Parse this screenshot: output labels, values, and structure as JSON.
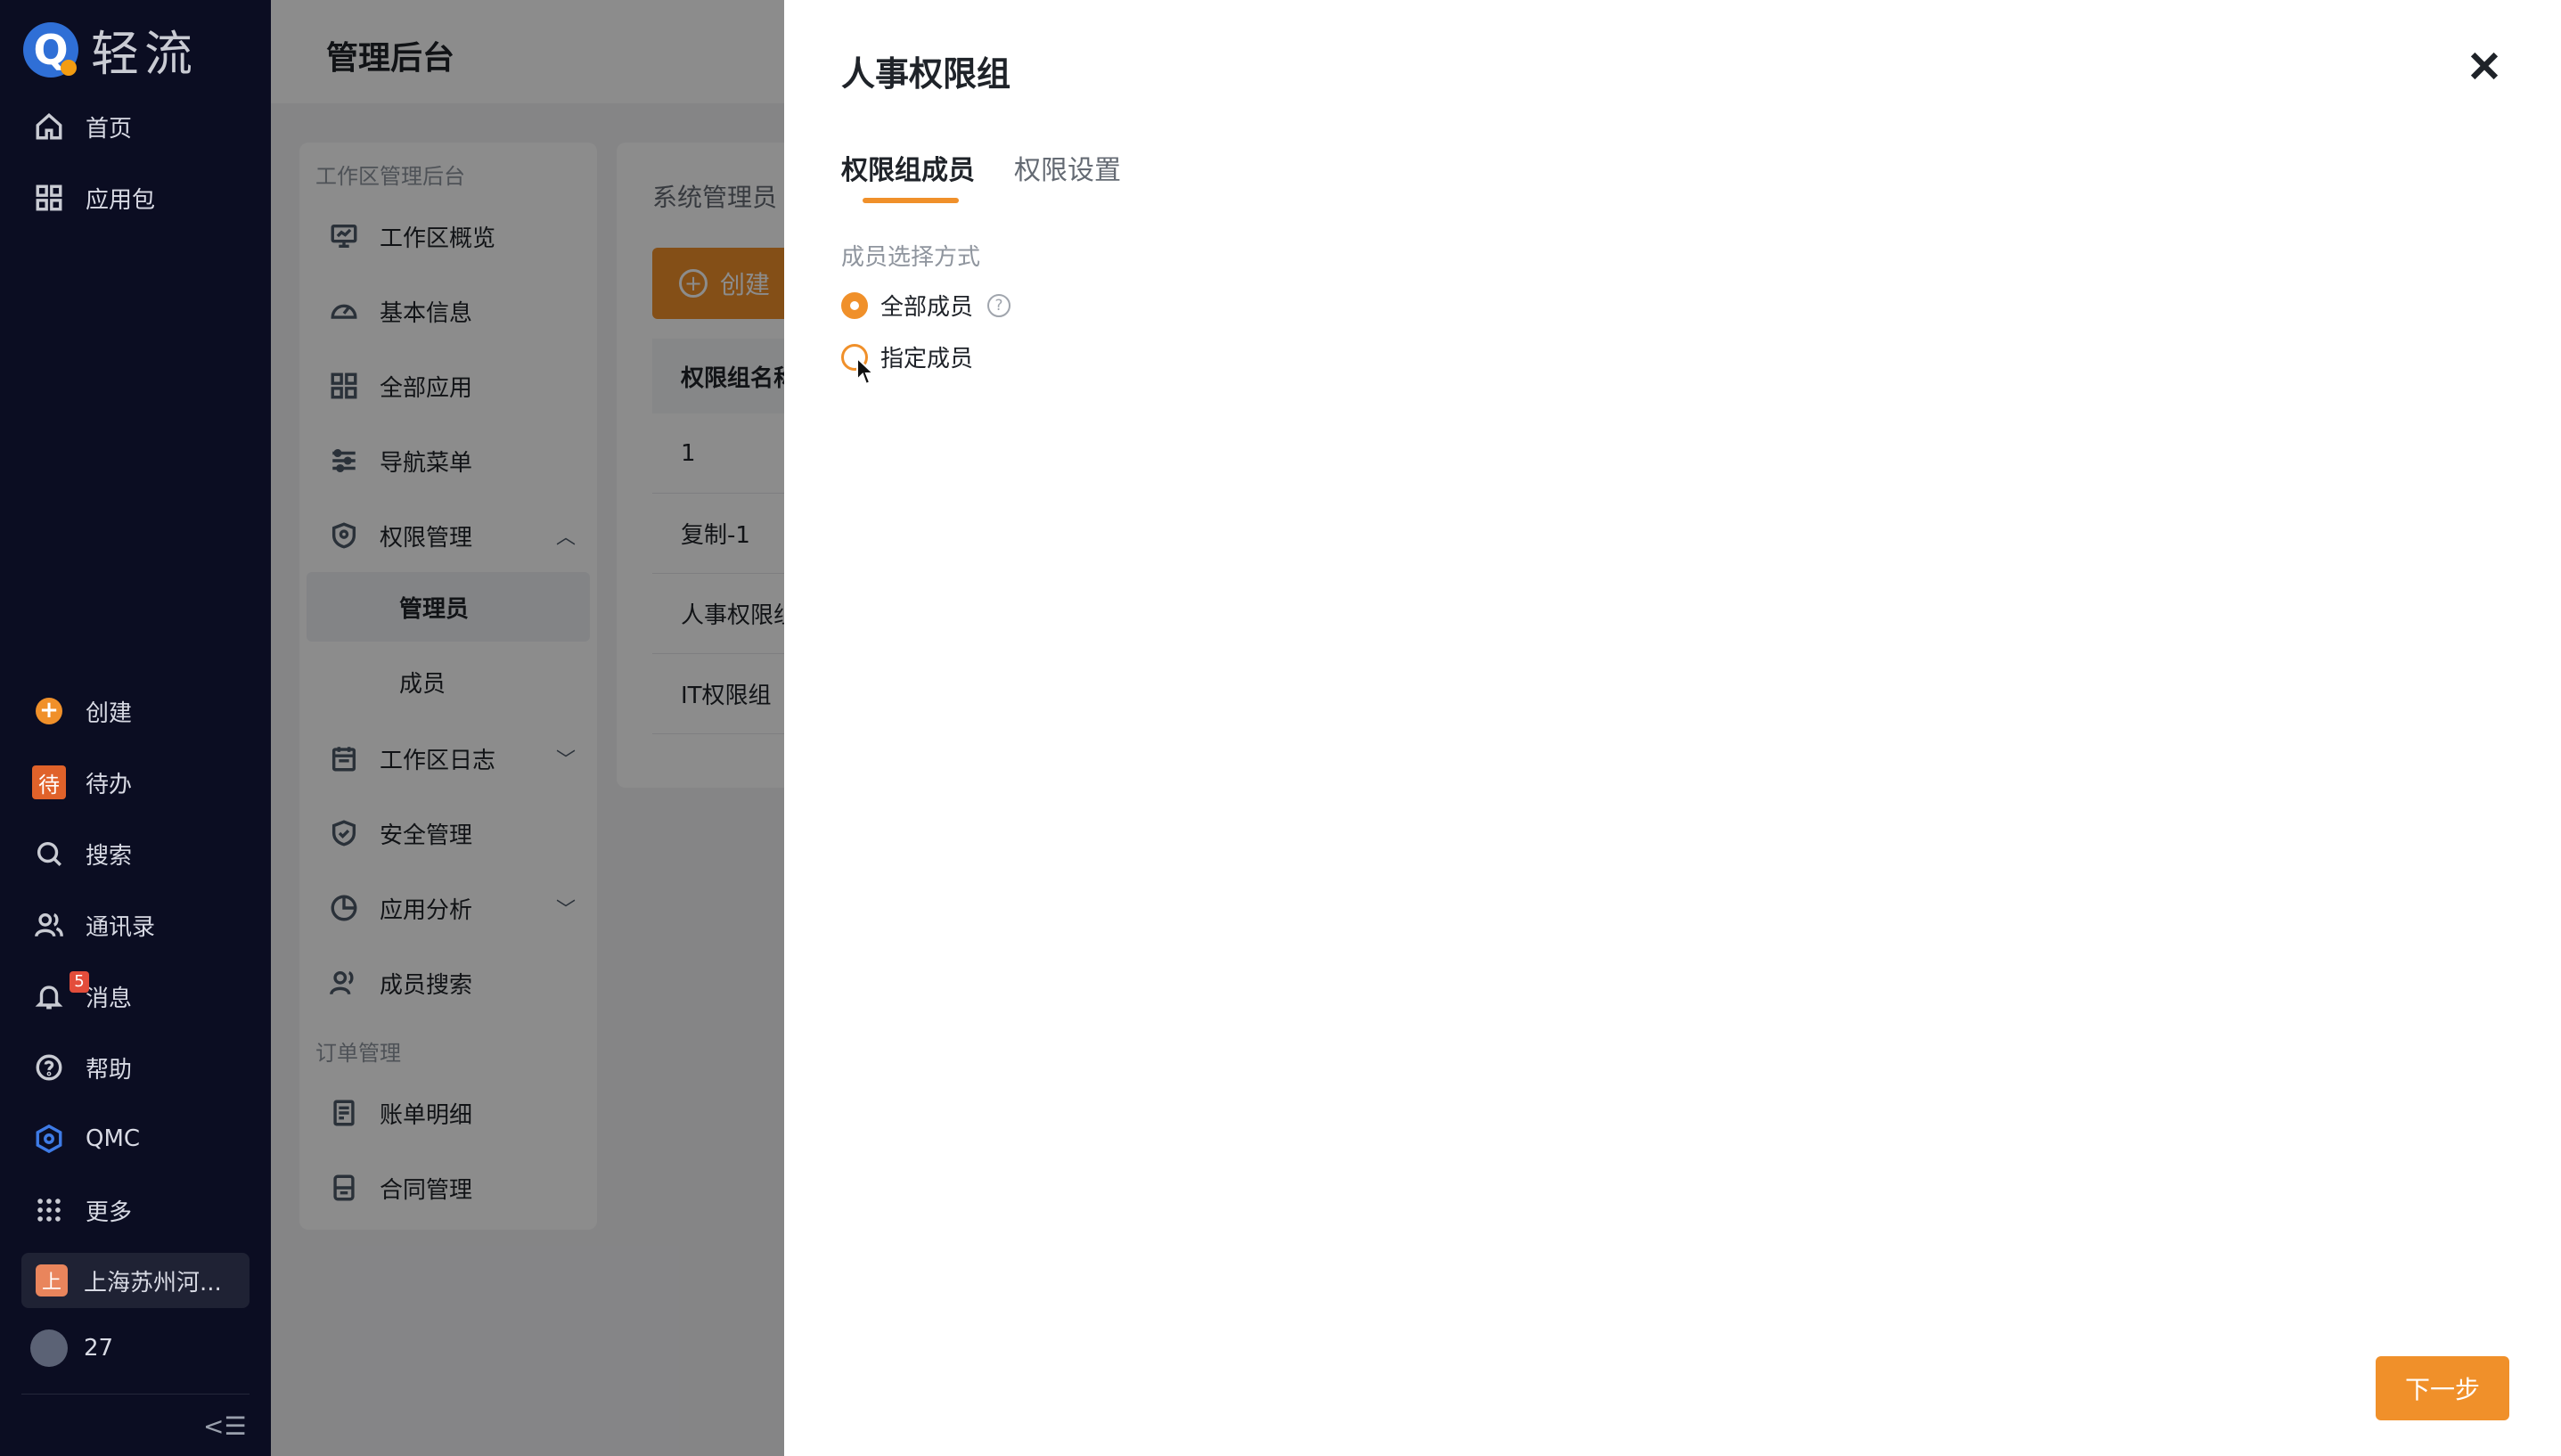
{
  "app": {
    "logo_letter": "Q",
    "logo_text": "轻流"
  },
  "sidebar": {
    "top_items": [
      {
        "label": "首页",
        "icon": "home-icon"
      },
      {
        "label": "应用包",
        "icon": "grid-icon"
      }
    ],
    "bottom_items": [
      {
        "label": "创建",
        "icon": "plus-circle-icon"
      },
      {
        "label": "待办",
        "icon": "todo-badge-icon",
        "badge_text": "待"
      },
      {
        "label": "搜索",
        "icon": "search-icon"
      },
      {
        "label": "通讯录",
        "icon": "contacts-icon"
      },
      {
        "label": "消息",
        "icon": "bell-icon",
        "badge": "5"
      },
      {
        "label": "帮助",
        "icon": "help-icon"
      },
      {
        "label": "QMC",
        "icon": "qmc-icon"
      },
      {
        "label": "更多",
        "icon": "apps-icon"
      }
    ],
    "company": {
      "avatar": "上",
      "name": "上海苏州河..."
    },
    "user": {
      "name": "27"
    },
    "collapse_icon": "collapse-icon"
  },
  "header": {
    "title": "管理后台"
  },
  "admin_menu": {
    "group1": "工作区管理后台",
    "items": [
      {
        "label": "工作区概览",
        "icon": "monitor-icon"
      },
      {
        "label": "基本信息",
        "icon": "dashboard-icon"
      },
      {
        "label": "全部应用",
        "icon": "apps-grid-icon"
      },
      {
        "label": "导航菜单",
        "icon": "sliders-icon"
      },
      {
        "label": "权限管理",
        "icon": "shield-icon",
        "chevron": "︿"
      }
    ],
    "sub_items": [
      {
        "label": "管理员",
        "active": true
      },
      {
        "label": "成员",
        "active": false
      }
    ],
    "items2": [
      {
        "label": "工作区日志",
        "icon": "calendar-icon",
        "chevron": "﹀"
      },
      {
        "label": "安全管理",
        "icon": "shield-check-icon"
      },
      {
        "label": "应用分析",
        "icon": "pie-icon",
        "chevron": "﹀"
      },
      {
        "label": "成员搜索",
        "icon": "users-icon"
      }
    ],
    "group2": "订单管理",
    "items3": [
      {
        "label": "账单明细",
        "icon": "bill-icon"
      },
      {
        "label": "合同管理",
        "icon": "contract-icon"
      }
    ]
  },
  "content": {
    "section_label": "系统管理员",
    "create_button": "创建",
    "table_header": "权限组名称",
    "rows": [
      "1",
      "复制-1",
      "人事权限组",
      "IT权限组"
    ]
  },
  "drawer": {
    "title": "人事权限组",
    "close_icon": "close-icon",
    "tabs": [
      {
        "label": "权限组成员",
        "active": true
      },
      {
        "label": "权限设置",
        "active": false
      }
    ],
    "section_label": "成员选择方式",
    "options": [
      {
        "label": "全部成员",
        "checked": true
      },
      {
        "label": "指定成员",
        "checked": false
      }
    ],
    "next_button": "下一步"
  },
  "colors": {
    "accent": "#f0902a",
    "sidebar_bg": "#0b0d22"
  }
}
